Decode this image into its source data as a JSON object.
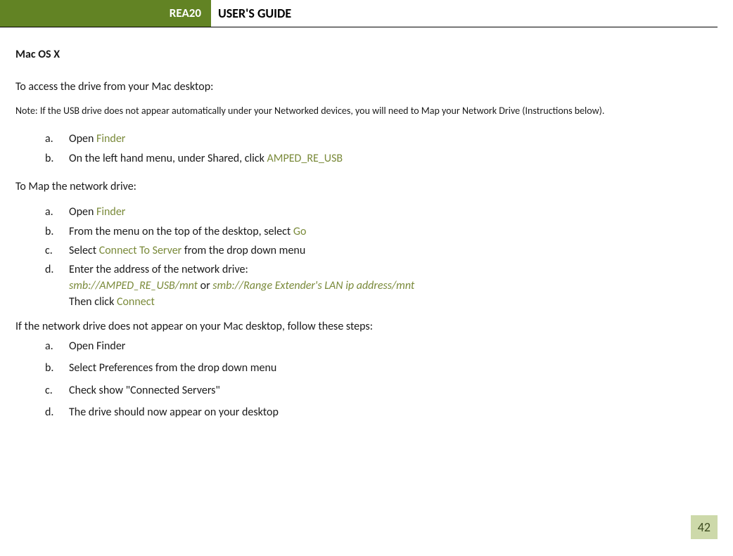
{
  "header": {
    "badge": "REA20",
    "title": "USER'S GUIDE"
  },
  "section": {
    "heading": "Mac OS X",
    "intro1": "To access the drive from your Mac desktop:",
    "note": "Note: If the USB drive does not appear automatically under your Networked devices, you will need to Map your Network Drive (Instructions below).",
    "list1": {
      "a": {
        "marker": "a.",
        "prefix": "Open ",
        "finder": "Finder"
      },
      "b": {
        "marker": "b.",
        "prefix": "On the left hand menu, under Shared, click ",
        "link": "AMPED_RE_USB"
      }
    },
    "intro2": "To Map the network drive:",
    "list2": {
      "a": {
        "marker": "a.",
        "prefix": "Open ",
        "finder": "Finder"
      },
      "b": {
        "marker": "b.",
        "prefix": "From the menu on the top of the desktop, select ",
        "go": "Go"
      },
      "c": {
        "marker": "c.",
        "prefix": "Select ",
        "connect": "Connect To Server",
        "suffix": " from the drop down menu"
      },
      "d": {
        "marker": "d.",
        "line1": "Enter the address of the network drive:",
        "smb1": "smb://AMPED_RE_USB/mnt",
        "or": " or ",
        "smb2": "smb://Range Extender's LAN ip address/mnt",
        "line3a": "Then click ",
        "line3b": "Connect"
      }
    },
    "follow": {
      "intro": "If the network drive does not appear on your Mac desktop, follow these steps:",
      "a": {
        "marker": "a.",
        "text": "Open Finder"
      },
      "b": {
        "marker": "b.",
        "text": "Select Preferences from the drop down menu"
      },
      "c": {
        "marker": "c.",
        "text": "Check show \"Connected Servers\""
      },
      "d": {
        "marker": "d.",
        "text": "The drive should now appear on your desktop"
      }
    }
  },
  "page_number": "42"
}
